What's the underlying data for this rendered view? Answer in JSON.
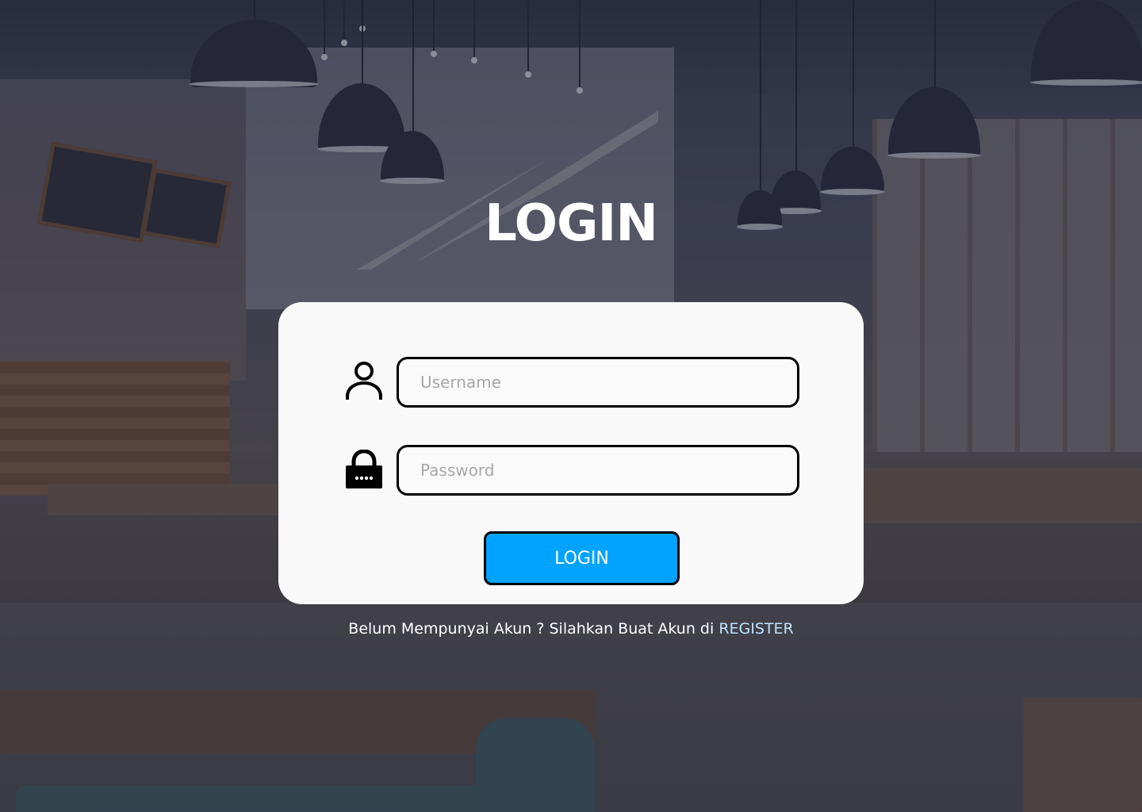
{
  "page": {
    "title": "LOGIN"
  },
  "form": {
    "username": {
      "placeholder": "Username",
      "value": "",
      "icon": "user-icon"
    },
    "password": {
      "placeholder": "Password",
      "value": "",
      "icon": "lock-icon"
    },
    "submit_label": "LOGIN"
  },
  "footer": {
    "prompt_text": "Belum Mempunyai Akun ? Silahkan Buat Akun di ",
    "register_link_label": "REGISTER"
  },
  "colors": {
    "accent": "#00A3FF",
    "card_background": "#F9F9F9",
    "link": "#BFE3FF"
  }
}
